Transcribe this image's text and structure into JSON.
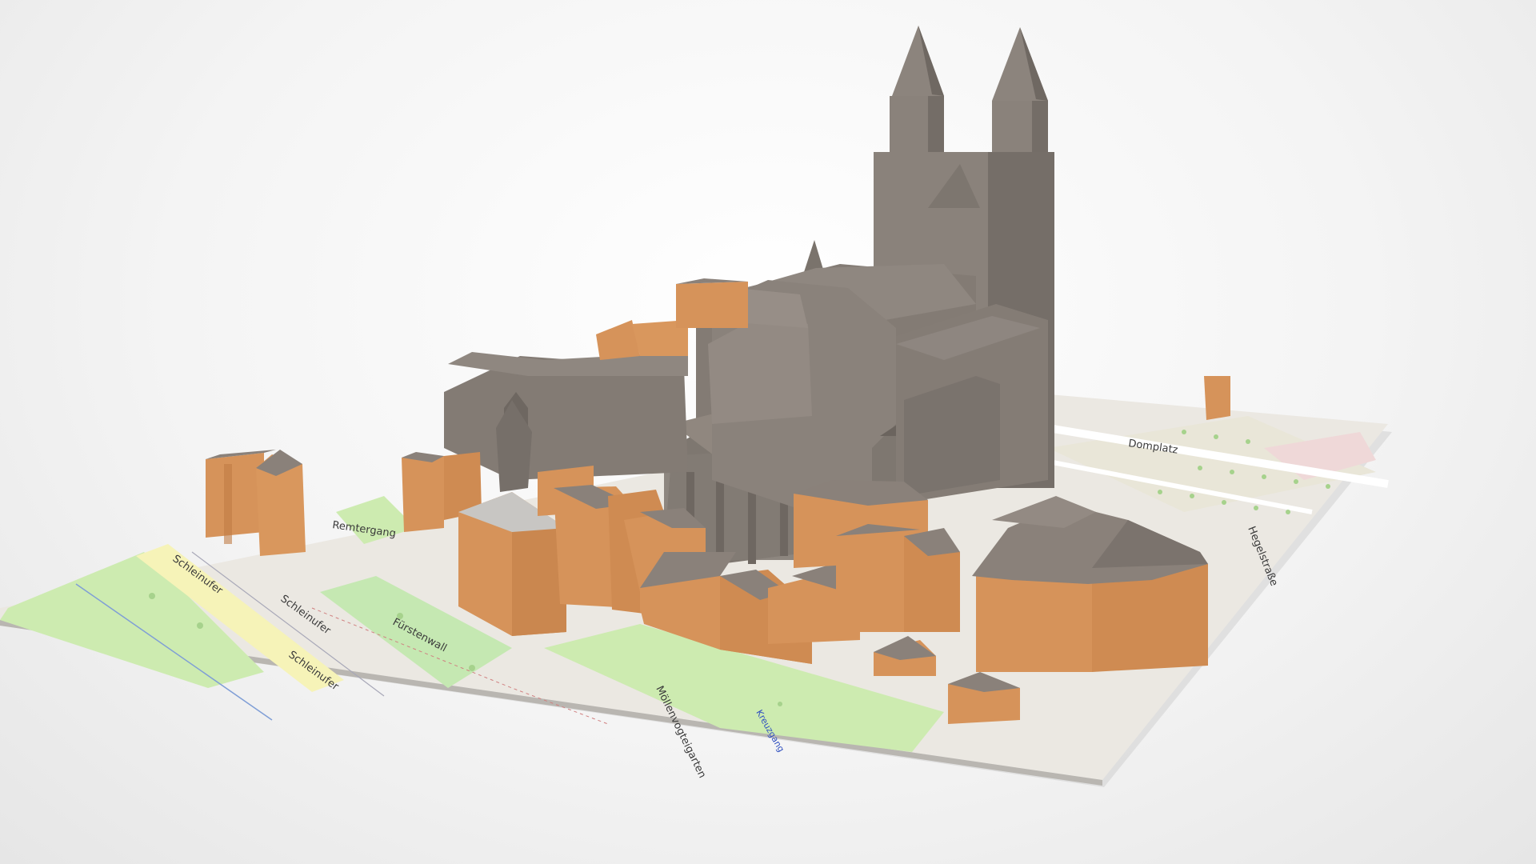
{
  "scene": {
    "title": "",
    "description_visible_text": "",
    "colors": {
      "background": "#f2f2f2",
      "map_base": "#ece9e3",
      "park_green": "#cdebb0",
      "road_yellow": "#f6f3b8",
      "pedestrian_pink": "#efd8d8",
      "building_orange": "#d6935a",
      "building_orange_dark": "#c07c45",
      "roof_grey": "#8a817a",
      "cathedral_grey": "#857d76",
      "cathedral_grey_dark": "#6e6761",
      "tree_dot": "#a6d28c"
    }
  },
  "map_labels": {
    "street_left_1": "Schleinufer",
    "street_left_2": "Schleinufer",
    "street_left_3": "Schleinufer",
    "street_mid_1": "Fürstenwall",
    "street_mid_2": "Remtergang",
    "square_label": "Möllenvogteigarten",
    "garden_label": "Kreuzgang",
    "street_small_1": "Domplatz",
    "street_small_2": "Hegelstraße"
  }
}
